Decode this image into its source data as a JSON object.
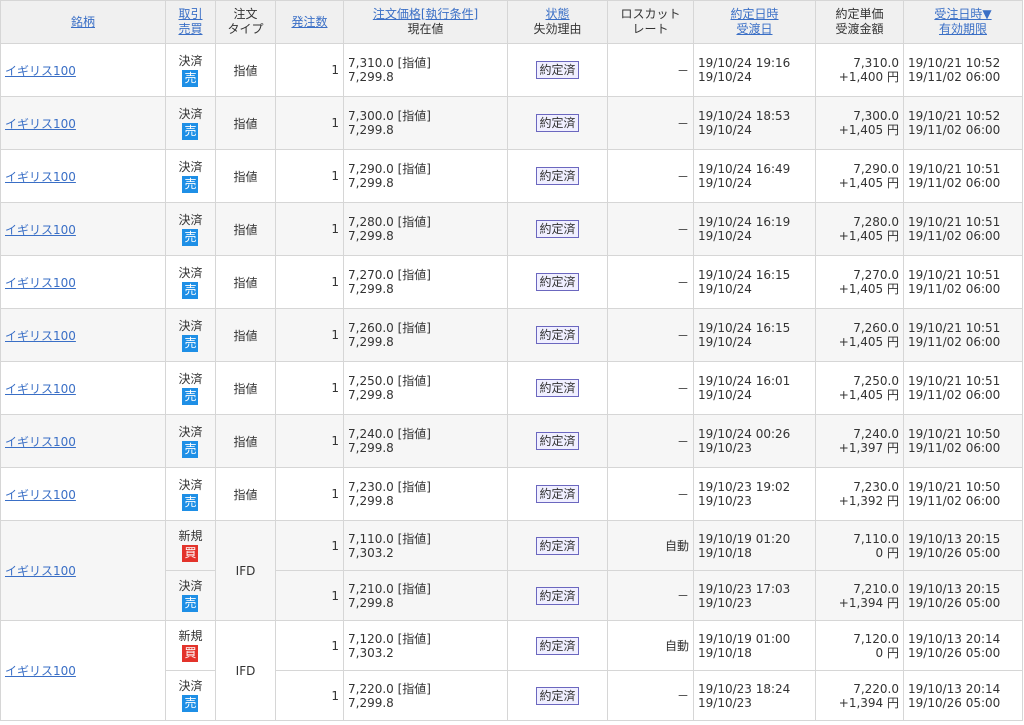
{
  "headers": {
    "symbol": "銘柄",
    "trade_a": "取引",
    "trade_b": "売買",
    "order_type_a": "注文",
    "order_type_b": "タイプ",
    "qty": "発注数",
    "price_a": "注文価格[執行条件]",
    "price_b": "現在値",
    "state_a": "状態",
    "state_b": "失効理由",
    "losscut_a": "ロスカット",
    "losscut_b": "レート",
    "exec_a": "約定日時",
    "exec_b": "受渡日",
    "unit_a": "約定単価",
    "unit_b": "受渡金額",
    "recv_a": "受注日時▼",
    "recv_b": "有効期限"
  },
  "rows": [
    {
      "symbol": "イギリス100",
      "trade": "決済",
      "side": "売",
      "side_type": "sell",
      "order_type": "指値",
      "qty": "1",
      "order_price": "7,310.0 [指値]",
      "current": "7,299.8",
      "status": "約定済",
      "losscut": "－",
      "exec_time": "19/10/24 19:16",
      "settle_date": "19/10/24",
      "exec_price": "7,310.0",
      "amount": "+1,400 円",
      "recv_time": "19/10/21 10:52",
      "expiry": "19/11/02 06:00"
    },
    {
      "symbol": "イギリス100",
      "trade": "決済",
      "side": "売",
      "side_type": "sell",
      "order_type": "指値",
      "qty": "1",
      "order_price": "7,300.0 [指値]",
      "current": "7,299.8",
      "status": "約定済",
      "losscut": "－",
      "exec_time": "19/10/24 18:53",
      "settle_date": "19/10/24",
      "exec_price": "7,300.0",
      "amount": "+1,405 円",
      "recv_time": "19/10/21 10:52",
      "expiry": "19/11/02 06:00"
    },
    {
      "symbol": "イギリス100",
      "trade": "決済",
      "side": "売",
      "side_type": "sell",
      "order_type": "指値",
      "qty": "1",
      "order_price": "7,290.0 [指値]",
      "current": "7,299.8",
      "status": "約定済",
      "losscut": "－",
      "exec_time": "19/10/24 16:49",
      "settle_date": "19/10/24",
      "exec_price": "7,290.0",
      "amount": "+1,405 円",
      "recv_time": "19/10/21 10:51",
      "expiry": "19/11/02 06:00"
    },
    {
      "symbol": "イギリス100",
      "trade": "決済",
      "side": "売",
      "side_type": "sell",
      "order_type": "指値",
      "qty": "1",
      "order_price": "7,280.0 [指値]",
      "current": "7,299.8",
      "status": "約定済",
      "losscut": "－",
      "exec_time": "19/10/24 16:19",
      "settle_date": "19/10/24",
      "exec_price": "7,280.0",
      "amount": "+1,405 円",
      "recv_time": "19/10/21 10:51",
      "expiry": "19/11/02 06:00"
    },
    {
      "symbol": "イギリス100",
      "trade": "決済",
      "side": "売",
      "side_type": "sell",
      "order_type": "指値",
      "qty": "1",
      "order_price": "7,270.0 [指値]",
      "current": "7,299.8",
      "status": "約定済",
      "losscut": "－",
      "exec_time": "19/10/24 16:15",
      "settle_date": "19/10/24",
      "exec_price": "7,270.0",
      "amount": "+1,405 円",
      "recv_time": "19/10/21 10:51",
      "expiry": "19/11/02 06:00"
    },
    {
      "symbol": "イギリス100",
      "trade": "決済",
      "side": "売",
      "side_type": "sell",
      "order_type": "指値",
      "qty": "1",
      "order_price": "7,260.0 [指値]",
      "current": "7,299.8",
      "status": "約定済",
      "losscut": "－",
      "exec_time": "19/10/24 16:15",
      "settle_date": "19/10/24",
      "exec_price": "7,260.0",
      "amount": "+1,405 円",
      "recv_time": "19/10/21 10:51",
      "expiry": "19/11/02 06:00"
    },
    {
      "symbol": "イギリス100",
      "trade": "決済",
      "side": "売",
      "side_type": "sell",
      "order_type": "指値",
      "qty": "1",
      "order_price": "7,250.0 [指値]",
      "current": "7,299.8",
      "status": "約定済",
      "losscut": "－",
      "exec_time": "19/10/24 16:01",
      "settle_date": "19/10/24",
      "exec_price": "7,250.0",
      "amount": "+1,405 円",
      "recv_time": "19/10/21 10:51",
      "expiry": "19/11/02 06:00"
    },
    {
      "symbol": "イギリス100",
      "trade": "決済",
      "side": "売",
      "side_type": "sell",
      "order_type": "指値",
      "qty": "1",
      "order_price": "7,240.0 [指値]",
      "current": "7,299.8",
      "status": "約定済",
      "losscut": "－",
      "exec_time": "19/10/24 00:26",
      "settle_date": "19/10/23",
      "exec_price": "7,240.0",
      "amount": "+1,397 円",
      "recv_time": "19/10/21 10:50",
      "expiry": "19/11/02 06:00"
    },
    {
      "symbol": "イギリス100",
      "trade": "決済",
      "side": "売",
      "side_type": "sell",
      "order_type": "指値",
      "qty": "1",
      "order_price": "7,230.0 [指値]",
      "current": "7,299.8",
      "status": "約定済",
      "losscut": "－",
      "exec_time": "19/10/23 19:02",
      "settle_date": "19/10/23",
      "exec_price": "7,230.0",
      "amount": "+1,392 円",
      "recv_time": "19/10/21 10:50",
      "expiry": "19/11/02 06:00"
    }
  ],
  "ifd_groups": [
    {
      "symbol": "イギリス100",
      "order_type": "IFD",
      "legs": [
        {
          "trade": "新規",
          "side": "買",
          "side_type": "buy",
          "qty": "1",
          "order_price": "7,110.0 [指値]",
          "current": "7,303.2",
          "status": "約定済",
          "losscut": "自動",
          "exec_time": "19/10/19 01:20",
          "settle_date": "19/10/18",
          "exec_price": "7,110.0",
          "amount": "0 円",
          "recv_time": "19/10/13 20:15",
          "expiry": "19/10/26 05:00"
        },
        {
          "trade": "決済",
          "side": "売",
          "side_type": "sell",
          "qty": "1",
          "order_price": "7,210.0 [指値]",
          "current": "7,299.8",
          "status": "約定済",
          "losscut": "－",
          "exec_time": "19/10/23 17:03",
          "settle_date": "19/10/23",
          "exec_price": "7,210.0",
          "amount": "+1,394 円",
          "recv_time": "19/10/13 20:15",
          "expiry": "19/10/26 05:00"
        }
      ]
    },
    {
      "symbol": "イギリス100",
      "order_type": "IFD",
      "legs": [
        {
          "trade": "新規",
          "side": "買",
          "side_type": "buy",
          "qty": "1",
          "order_price": "7,120.0 [指値]",
          "current": "7,303.2",
          "status": "約定済",
          "losscut": "自動",
          "exec_time": "19/10/19 01:00",
          "settle_date": "19/10/18",
          "exec_price": "7,120.0",
          "amount": "0 円",
          "recv_time": "19/10/13 20:14",
          "expiry": "19/10/26 05:00"
        },
        {
          "trade": "決済",
          "side": "売",
          "side_type": "sell",
          "qty": "1",
          "order_price": "7,220.0 [指値]",
          "current": "7,299.8",
          "status": "約定済",
          "losscut": "－",
          "exec_time": "19/10/23 18:24",
          "settle_date": "19/10/23",
          "exec_price": "7,220.0",
          "amount": "+1,394 円",
          "recv_time": "19/10/13 20:14",
          "expiry": "19/10/26 05:00"
        }
      ]
    }
  ]
}
